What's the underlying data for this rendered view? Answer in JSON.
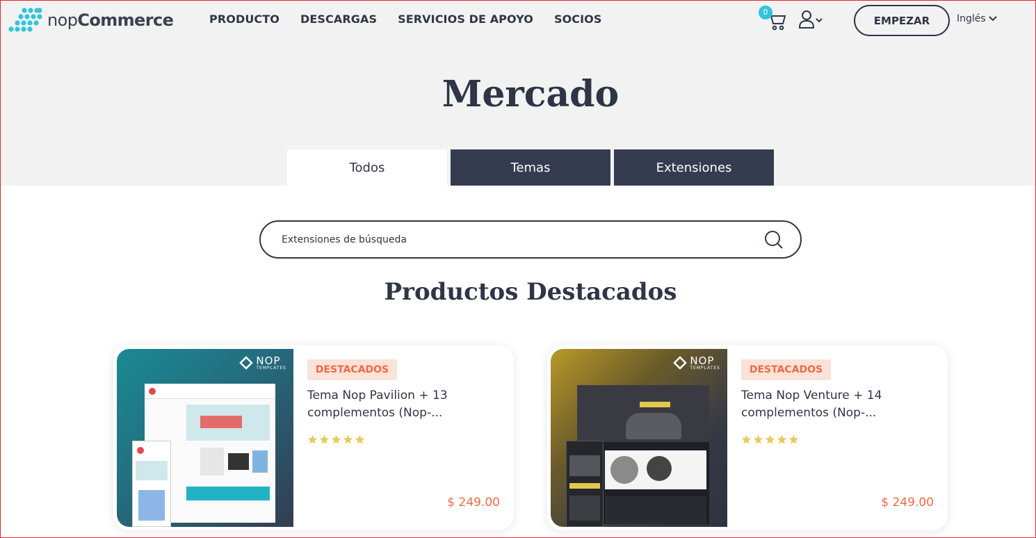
{
  "brand": {
    "logo_light": "nop",
    "logo_bold": "Commerce"
  },
  "nav": {
    "items": [
      "PRODUCTO",
      "DESCARGAS",
      "SERVICIOS DE APOYO",
      "SOCIOS"
    ]
  },
  "header": {
    "cart_count": "0",
    "start_label": "EMPEZAR",
    "language": "Inglés"
  },
  "page": {
    "title": "Mercado",
    "tabs": [
      {
        "label": "Todos",
        "active": true
      },
      {
        "label": "Temas",
        "active": false
      },
      {
        "label": "Extensiones",
        "active": false
      }
    ],
    "search_placeholder": "Extensiones de búsqueda",
    "section_title": "Productos Destacados"
  },
  "products": [
    {
      "badge": "DESTACADOS",
      "name": "Tema Nop Pavilion + 13 complementos (Nop-...",
      "rating": 5,
      "price": "$ 249.00",
      "thumb_brand_big": "NOP",
      "thumb_brand_small": "TEMPLATES"
    },
    {
      "badge": "DESTACADOS",
      "name": "Tema Nop Venture + 14 complementos (Nop-...",
      "rating": 5,
      "price": "$ 249.00",
      "thumb_brand_big": "NOP",
      "thumb_brand_small": "TEMPLATES"
    }
  ],
  "colors": {
    "accent": "#f06a42",
    "dark": "#353c4f",
    "cyan": "#30c5dc",
    "star": "#e8c95a"
  }
}
